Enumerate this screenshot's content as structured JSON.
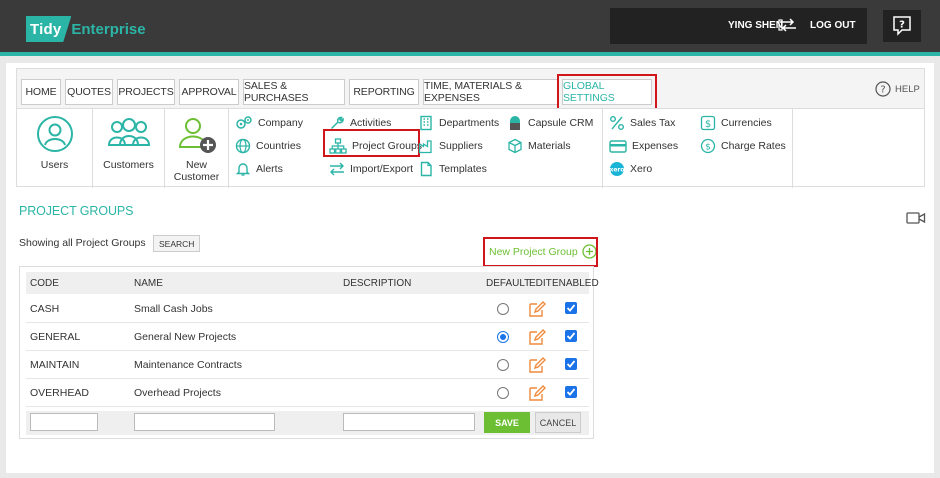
{
  "header": {
    "logo_box": "Tidy",
    "logo_text": "Enterprise",
    "user_name": "YING SHEN",
    "logout_label": "LOG OUT"
  },
  "nav": {
    "tabs": [
      {
        "label": "HOME"
      },
      {
        "label": "QUOTES"
      },
      {
        "label": "PROJECTS"
      },
      {
        "label": "APPROVAL"
      },
      {
        "label": "SALES & PURCHASES"
      },
      {
        "label": "REPORTING"
      },
      {
        "label": "TIME, MATERIALS & EXPENSES"
      },
      {
        "label": "GLOBAL SETTINGS"
      }
    ],
    "help_label": "HELP"
  },
  "submenu": {
    "users": "Users",
    "customers": "Customers",
    "new_customer_1": "New",
    "new_customer_2": "Customer",
    "company": "Company",
    "countries": "Countries",
    "alerts": "Alerts",
    "activities": "Activities",
    "project_groups": "Project Groups",
    "import_export": "Import/Export",
    "departments": "Departments",
    "suppliers": "Suppliers",
    "templates": "Templates",
    "capsule_crm": "Capsule CRM",
    "materials": "Materials",
    "sales_tax": "Sales Tax",
    "expenses": "Expenses",
    "xero": "Xero",
    "currencies": "Currencies",
    "charge_rates": "Charge Rates"
  },
  "page": {
    "title": "PROJECT GROUPS",
    "showing": "Showing all Project Groups",
    "search_label": "SEARCH",
    "new_group_label": "New Project Group"
  },
  "table": {
    "headers": {
      "code": "CODE",
      "name": "NAME",
      "description": "DESCRIPTION",
      "default": "DEFAULT",
      "edit": "EDIT",
      "enabled": "ENABLED"
    },
    "rows": [
      {
        "code": "CASH",
        "name": "Small Cash Jobs",
        "description": "",
        "default": false,
        "enabled": true
      },
      {
        "code": "GENERAL",
        "name": "General New Projects",
        "description": "",
        "default": true,
        "enabled": true
      },
      {
        "code": "MAINTAIN",
        "name": "Maintenance Contracts",
        "description": "",
        "default": false,
        "enabled": true
      },
      {
        "code": "OVERHEAD",
        "name": "Overhead Projects",
        "description": "",
        "default": false,
        "enabled": true
      }
    ],
    "save_label": "SAVE",
    "cancel_label": "CANCEL"
  },
  "colors": {
    "accent": "#2bb5a6",
    "highlight": "#d0161b",
    "save_green": "#6cbf33",
    "edit_orange": "#f08a3c"
  }
}
